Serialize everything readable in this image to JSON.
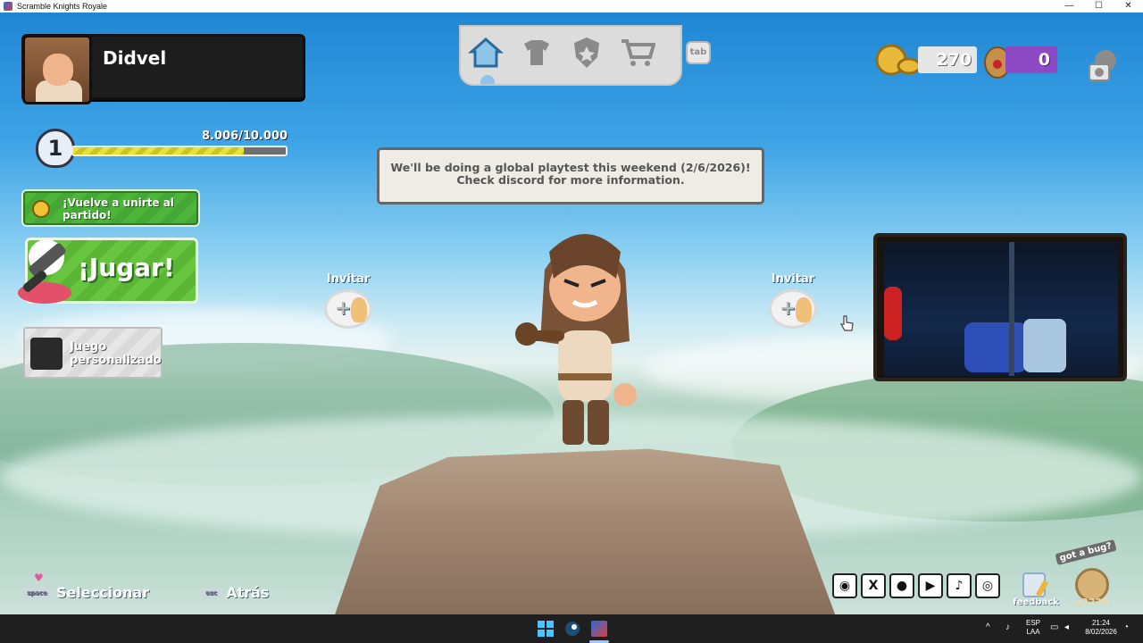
{
  "window": {
    "title": "Scramble Knights Royale",
    "min": "—",
    "max": "☐",
    "close": "✕"
  },
  "player": {
    "name": "Didvel",
    "level": "1",
    "xp_text": "8.006/10.000",
    "xp_fraction": 0.8006
  },
  "menu": {
    "rejoin_label": "¡Vuelve a unirte al partido!",
    "play_label": "¡Jugar!",
    "custom_label": "Juego personalizado"
  },
  "top_nav": {
    "items": [
      {
        "name": "home-icon"
      },
      {
        "name": "shirt-brush-icon"
      },
      {
        "name": "shield-star-icon"
      },
      {
        "name": "cart-icon"
      }
    ],
    "tab_hint": "tab"
  },
  "currency": {
    "coins": "270",
    "gems": "0"
  },
  "notice": "We'll be doing a global playtest this weekend (2/6/2026)! Check discord for more information.",
  "invite": {
    "left_label": "Invitar",
    "right_label": "Invitar"
  },
  "hints": {
    "select_key": "space",
    "select_label": "Seleccionar",
    "back_key": "esc",
    "back_label": "Atrás"
  },
  "social": [
    {
      "name": "discord-icon",
      "glyph": "◉"
    },
    {
      "name": "x-icon",
      "glyph": "X"
    },
    {
      "name": "reddit-icon",
      "glyph": "●"
    },
    {
      "name": "youtube-icon",
      "glyph": "▶"
    },
    {
      "name": "tiktok-icon",
      "glyph": "♪"
    },
    {
      "name": "steam-icon",
      "glyph": "◎"
    }
  ],
  "feedback_label": "feedback",
  "bug": {
    "label": "got a bug?",
    "version": "v2229"
  },
  "taskbar": {
    "lang_top": "ESP",
    "lang_bottom": "LAA",
    "time": "21:24",
    "date": "8/02/2026"
  },
  "colors": {
    "play_green": "#5bb636",
    "gem_purple": "#8e49c4",
    "xp_yellow": "#e7e33b"
  }
}
